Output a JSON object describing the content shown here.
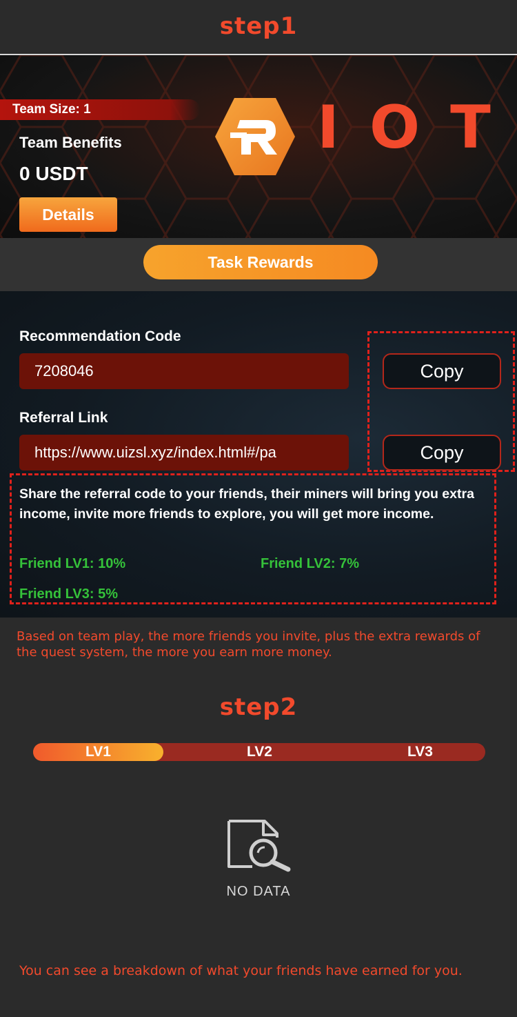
{
  "step1_title": "step1",
  "banner": {
    "team_size": "Team Size: 1",
    "team_benefits_label": "Team Benefits",
    "team_benefits_value": "0 USDT",
    "details_label": "Details",
    "logo_text": "IOT"
  },
  "task_rewards_label": "Task Rewards",
  "referral": {
    "code_label": "Recommendation Code",
    "code_value": "7208046",
    "link_label": "Referral Link",
    "link_value": "https://www.uizsl.xyz/index.html#/pa",
    "copy_label": "Copy",
    "share_text": "Share the referral code to your friends, their miners will bring you extra income, invite more friends to explore, you will get more income.",
    "friends": [
      "Friend LV1: 10%",
      "Friend LV2: 7%",
      "Friend LV3: 5%"
    ]
  },
  "info_text": "Based on team play, the more friends you invite, plus the extra rewards of the quest system, the more you earn more money.",
  "step2_title": "step2",
  "levels": [
    "LV1",
    "LV2",
    "LV3"
  ],
  "no_data": "NO DATA",
  "bottom_text": "You can see a breakdown of what your friends have earned for you.",
  "colors": {
    "accent": "#f24a2c",
    "friend_green": "#35c23a",
    "field_bg": "#6c1208"
  }
}
